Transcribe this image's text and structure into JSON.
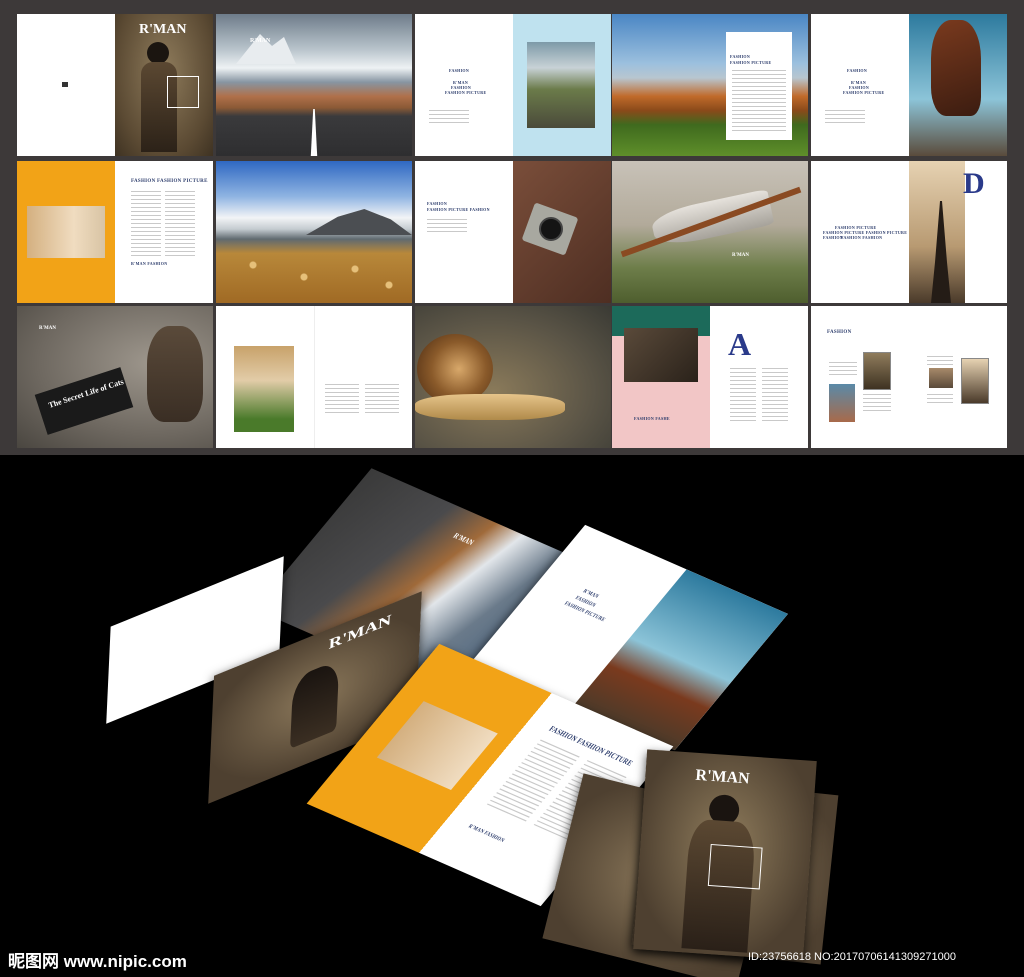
{
  "brand": {
    "cover_title": "R'MAN"
  },
  "thumbnails": {
    "s3_headings": [
      "FASHION",
      "R'MAN",
      "FASHION",
      "FASHION PICTURE"
    ],
    "s4_heading": "FASHION FASHION PICTURE",
    "s5_headings": [
      "FASHION",
      "R'MAN",
      "FASHION",
      "FASHION PICTURE"
    ],
    "s6_heading": "FASHION FASHION PICTURE",
    "s6_caption": "R'MAN FASHION",
    "s8_headings": [
      "FASHION",
      "FASHION PICTURE FASHION"
    ],
    "s10_headings": [
      "FASHION PICTURE",
      "FASHION PICTURE FASHION PICTURE FASHION",
      "FASHION FASHION"
    ],
    "s10_dropcap": "D",
    "s11_book": "The Secret Life of Cats",
    "s14_caption": "FASHION FASHE",
    "s14_dropcap": "A",
    "s15_heading": "FASHION"
  },
  "mockup": {
    "spread_heading": "FASHION FASHION PICTURE",
    "spread_caption": "R'MAN FASHION",
    "white_headings": [
      "R'MAN",
      "FASHION",
      "FASHION PICTURE"
    ]
  },
  "watermark": {
    "site": "昵图网 www.nipic.com",
    "id_text": "ID:23756618 NO:20170706141309271000"
  },
  "colors": {
    "accent_orange": "#f2a317",
    "navy": "#2a3a6a",
    "light_blue": "#bfe2ef",
    "pink": "#f2c6c6",
    "green": "#1c6a5a"
  }
}
